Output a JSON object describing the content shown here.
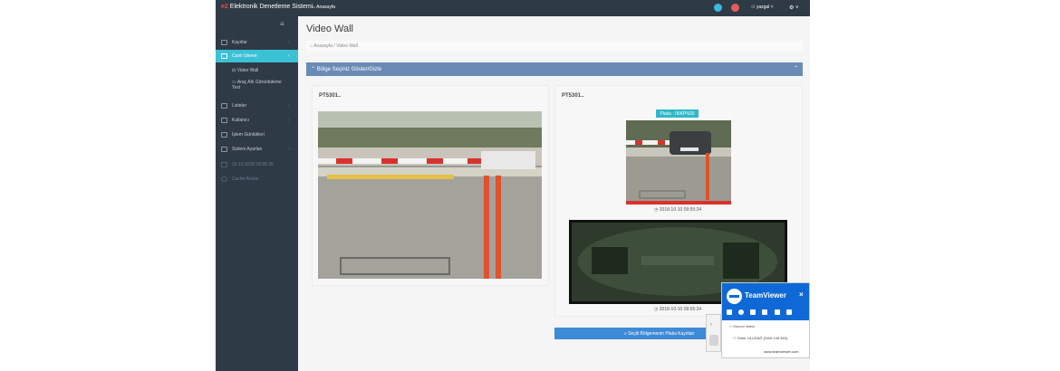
{
  "navbar": {
    "brand_logo": "e2",
    "brand_name": "Elektronik Denetleme Sistemi",
    "home_label": "Anasayfa",
    "user_label": "yazgal",
    "settings_caret": "⚙ ˅"
  },
  "sidebar": {
    "toggle_icon": "≡",
    "items": [
      {
        "label": "Kayıtlar",
        "icon": "list-icon"
      },
      {
        "label": "Canlı İzleme",
        "icon": "video-icon"
      },
      {
        "label": "Listeler",
        "icon": "list-icon"
      },
      {
        "label": "Kullanıcı",
        "icon": "user-icon"
      },
      {
        "label": "İşlem Günlükleri",
        "icon": "log-icon"
      },
      {
        "label": "Sistem Ayarları",
        "icon": "settings-icon"
      },
      {
        "label": "15.10.2018 09:55:36",
        "icon": "shield-icon"
      },
      {
        "label": "Cache Active",
        "icon": "info-icon"
      }
    ],
    "sub_items": [
      {
        "label": "Video Wall"
      },
      {
        "label": "Araç Altı Görüntüleme",
        "label2": "Test"
      }
    ]
  },
  "main": {
    "page_title": "Video Wall",
    "breadcrumb": {
      "home": "Anasayfa",
      "separator": "/",
      "current": "Video Wall"
    },
    "panel_title": "Bölge Seçiniz Göster/Gizle",
    "cameras": [
      {
        "title": "PT5301.."
      },
      {
        "title": "PT5301..",
        "plate_label": "Plaka : 06KPN30",
        "plate_time": "2018-10-10 09:55:24",
        "under_time": "2018-10-10 09:55:24"
      }
    ],
    "plate_button": "Seçili Bölgemenin Plaka Kayıtları"
  },
  "teamviewer": {
    "name": "TeamViewer",
    "close": "×",
    "status": "Oturum listesi",
    "session": "Ömer ULUDAĞ (DAN 108 563)",
    "link": "www.teamviewer.com"
  },
  "colors": {
    "topbar": "#2f3a47",
    "sidebar": "#2f3a47",
    "active_nav": "#3bc1d6",
    "panel_head": "#6a8bb5",
    "plate_button": "#3d8bd6",
    "teamviewer": "#0e69d6"
  }
}
